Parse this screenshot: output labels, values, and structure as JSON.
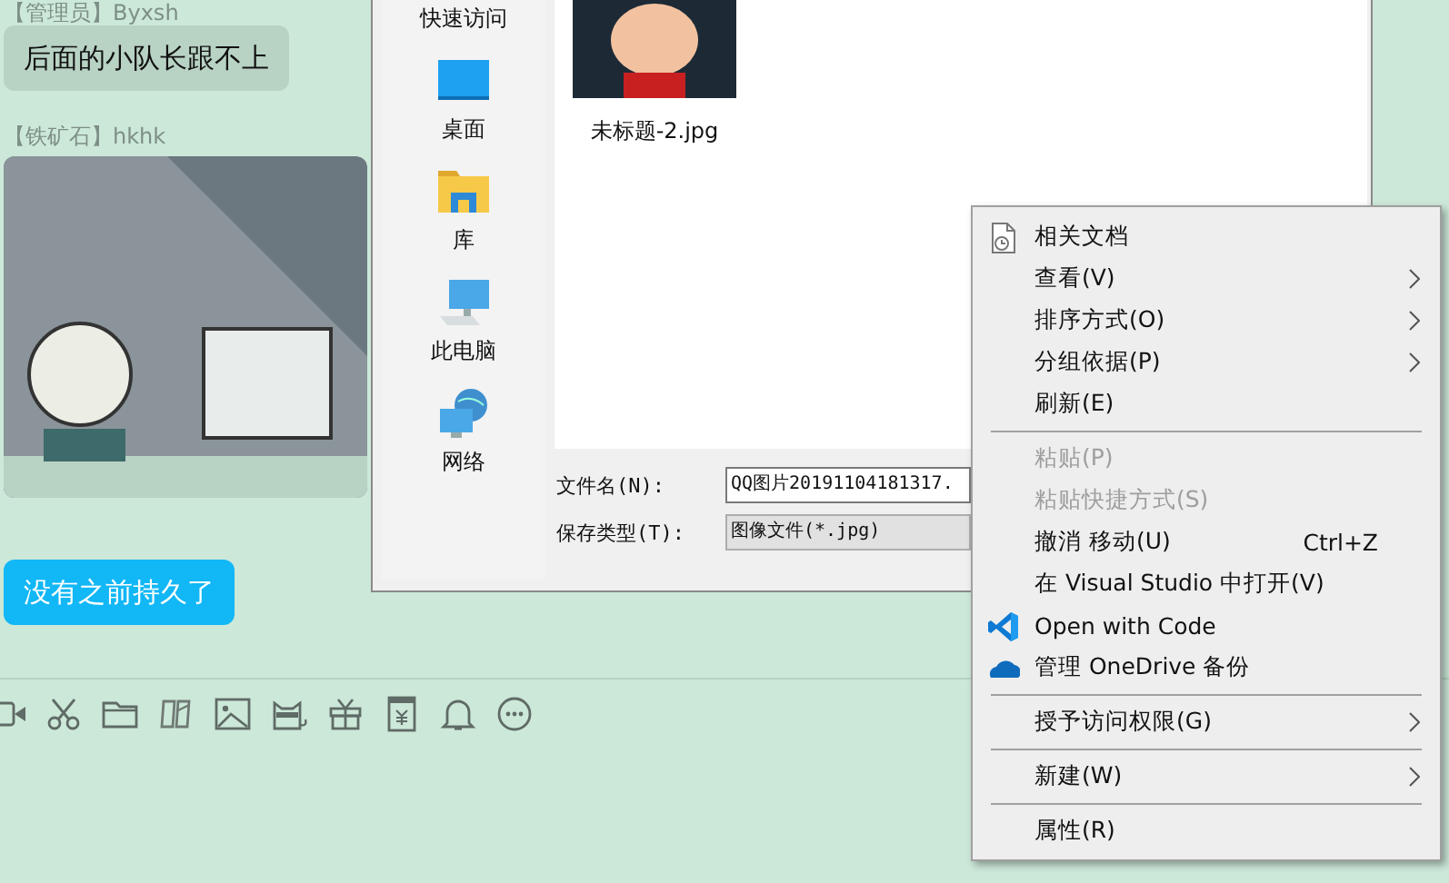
{
  "chat": {
    "messages": [
      {
        "kind": "text",
        "sender": "【管理员】Byxsh",
        "text": "后面的小队长跟不上",
        "mine": false
      },
      {
        "kind": "image",
        "sender": "【铁矿石】hkhk"
      },
      {
        "kind": "text",
        "text": "没有之前持久了",
        "mine": true
      }
    ]
  },
  "dialog": {
    "places": [
      {
        "label": "快速访问"
      },
      {
        "label": "桌面"
      },
      {
        "label": "库"
      },
      {
        "label": "此电脑"
      },
      {
        "label": "网络"
      }
    ],
    "files": [
      {
        "name": "未标题-2.jpg"
      }
    ],
    "filename": {
      "label": "文件名(N):",
      "value": "QQ图片20191104181317."
    },
    "filetype": {
      "label": "保存类型(T):",
      "value": "图像文件(*.jpg)"
    }
  },
  "menu": {
    "items": [
      {
        "kind": "item",
        "label": "相关文档",
        "disabled": false,
        "submenu": false
      },
      {
        "kind": "item",
        "label": "查看(V)",
        "disabled": false,
        "submenu": true
      },
      {
        "kind": "item",
        "label": "排序方式(O)",
        "disabled": false,
        "submenu": true
      },
      {
        "kind": "item",
        "label": "分组依据(P)",
        "disabled": false,
        "submenu": true
      },
      {
        "kind": "item",
        "label": "刷新(E)",
        "disabled": false,
        "submenu": false
      },
      {
        "kind": "separator"
      },
      {
        "kind": "item",
        "label": "粘贴(P)",
        "disabled": true,
        "submenu": false
      },
      {
        "kind": "item",
        "label": "粘贴快捷方式(S)",
        "disabled": true,
        "submenu": false
      },
      {
        "kind": "item",
        "label": "撤消 移动(U)",
        "shortcut": "Ctrl+Z",
        "disabled": false,
        "submenu": false
      },
      {
        "kind": "item",
        "label": "在 Visual Studio 中打开(V)",
        "disabled": false,
        "submenu": false
      },
      {
        "kind": "item",
        "label": "Open with Code",
        "disabled": false,
        "submenu": false
      },
      {
        "kind": "item",
        "label": "管理 OneDrive 备份",
        "disabled": false,
        "submenu": false
      },
      {
        "kind": "separator"
      },
      {
        "kind": "item",
        "label": "授予访问权限(G)",
        "disabled": false,
        "submenu": true
      },
      {
        "kind": "separator"
      },
      {
        "kind": "item",
        "label": "新建(W)",
        "disabled": false,
        "submenu": true
      },
      {
        "kind": "separator"
      },
      {
        "kind": "item",
        "label": "属性(R)",
        "disabled": false,
        "submenu": false
      }
    ]
  }
}
